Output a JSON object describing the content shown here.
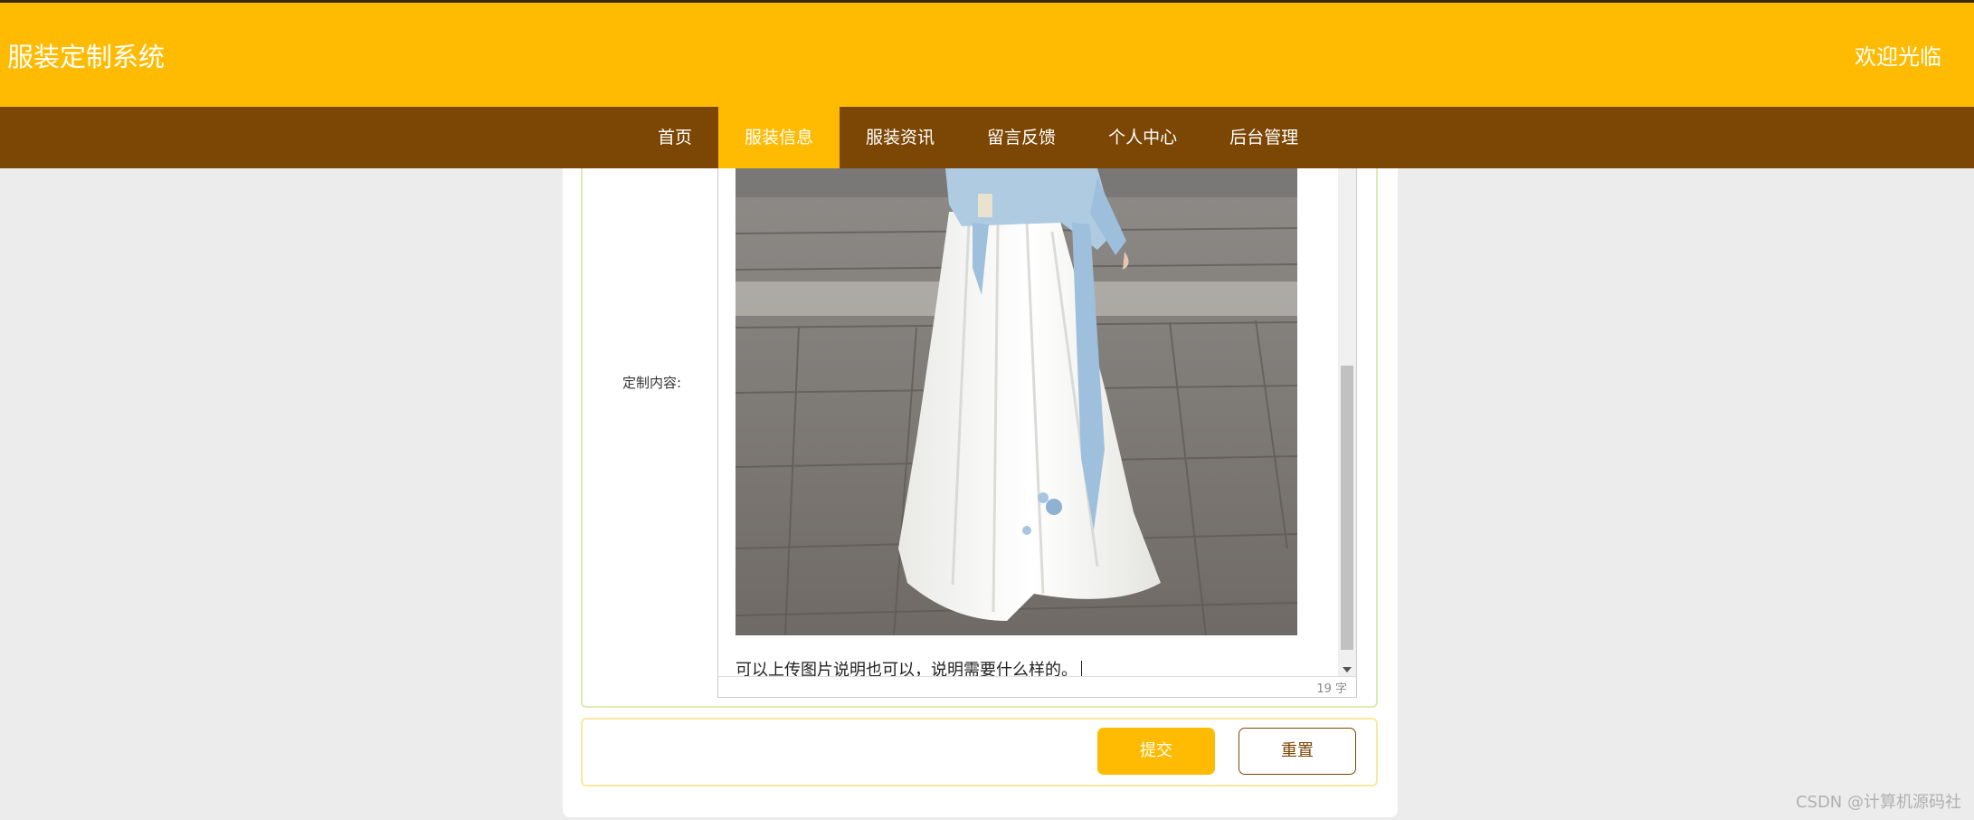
{
  "header": {
    "site_title": "服装定制系统",
    "welcome": "欢迎光临"
  },
  "nav": {
    "items": [
      {
        "label": "首页",
        "active": false
      },
      {
        "label": "服装信息",
        "active": true
      },
      {
        "label": "服装资讯",
        "active": false
      },
      {
        "label": "留言反馈",
        "active": false
      },
      {
        "label": "个人中心",
        "active": false
      },
      {
        "label": "后台管理",
        "active": false
      }
    ]
  },
  "form": {
    "content_label": "定制内容:",
    "editor_text": "可以上传图片说明也可以，说明需要什么样的。",
    "word_count": "19 字",
    "submit_label": "提交",
    "reset_label": "重置"
  },
  "watermark": "CSDN @计算机源码社",
  "colors": {
    "header_bg": "#ffbb02",
    "nav_bg": "#7c4704",
    "nav_active_bg": "#ffbb02",
    "page_bg": "#ececec"
  }
}
